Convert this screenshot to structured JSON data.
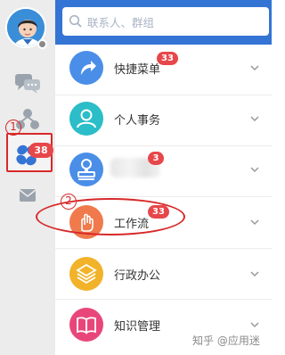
{
  "search": {
    "placeholder": "联系人、群组"
  },
  "sidebar": {
    "items": [
      {
        "icon": "chat-bubbles-icon"
      },
      {
        "icon": "org-tree-icon"
      },
      {
        "icon": "apps-pinwheel-icon",
        "badge": "38",
        "selected": true
      },
      {
        "icon": "mail-icon"
      }
    ]
  },
  "annotations": {
    "one": "1",
    "two": "2"
  },
  "apps": [
    {
      "label": "快捷菜单",
      "badge": "33",
      "icon": "shortcut-arrow-icon",
      "color": "#4a8ee8"
    },
    {
      "label": "个人事务",
      "badge": "",
      "icon": "person-icon",
      "color": "#2bbdc8"
    },
    {
      "label": "",
      "badge": "3",
      "icon": "stamp-icon",
      "color": "#4a8ee8"
    },
    {
      "label": "工作流",
      "badge": "33",
      "icon": "workflow-hand-icon",
      "color": "#f07a4c"
    },
    {
      "label": "行政办公",
      "badge": "",
      "icon": "layers-icon",
      "color": "#f2b32a"
    },
    {
      "label": "知识管理",
      "badge": "",
      "icon": "book-icon",
      "color": "#e8467a"
    }
  ],
  "watermark": "知乎 @应用迷",
  "colors": {
    "topbar": "#3474d4",
    "badge": "#e7474a",
    "annotation": "#d8292a",
    "rail": "#ececec"
  }
}
